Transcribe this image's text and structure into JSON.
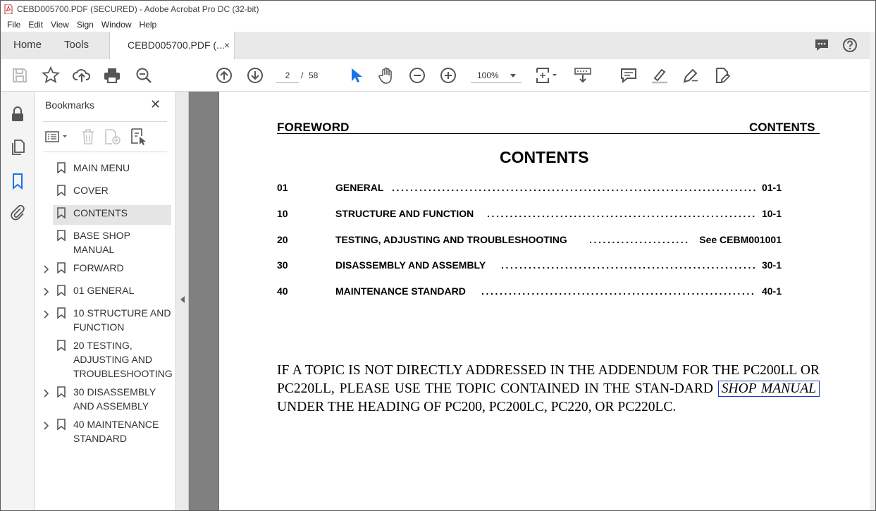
{
  "window": {
    "title": "CEBD005700.PDF (SECURED) - Adobe Acrobat Pro DC (32-bit)"
  },
  "menu": [
    "File",
    "Edit",
    "View",
    "Sign",
    "Window",
    "Help"
  ],
  "tabs": {
    "home": "Home",
    "tools": "Tools",
    "document": "CEBD005700.PDF (...",
    "close": "×"
  },
  "toolbar": {
    "page_current": "2",
    "page_sep": "/",
    "page_total": "58",
    "zoom": "100%"
  },
  "bookmarks": {
    "title": "Bookmarks",
    "close": "✕",
    "items": [
      {
        "label": "MAIN MENU",
        "expandable": false,
        "selected": false
      },
      {
        "label": "COVER",
        "expandable": false,
        "selected": false
      },
      {
        "label": "CONTENTS",
        "expandable": false,
        "selected": true
      },
      {
        "label": "BASE SHOP MANUAL",
        "expandable": false,
        "selected": false
      },
      {
        "label": "FORWARD",
        "expandable": true,
        "selected": false
      },
      {
        "label": "01 GENERAL",
        "expandable": true,
        "selected": false
      },
      {
        "label": "10 STRUCTURE AND FUNCTION",
        "expandable": true,
        "selected": false
      },
      {
        "label": "20 TESTING, ADJUSTING AND TROUBLESHOOTING",
        "expandable": false,
        "selected": false
      },
      {
        "label": "30 DISASSEMBLY AND ASSEMBLY",
        "expandable": true,
        "selected": false
      },
      {
        "label": "40 MAINTENANCE STANDARD",
        "expandable": true,
        "selected": false
      }
    ]
  },
  "document": {
    "header_left": "FOREWORD",
    "header_right": "CONTENTS",
    "title": "CONTENTS",
    "toc": [
      {
        "num": "01",
        "title": "GENERAL",
        "page": "01-1"
      },
      {
        "num": "10",
        "title": "STRUCTURE AND FUNCTION",
        "page": "10-1"
      },
      {
        "num": "20",
        "title": "TESTING, ADJUSTING AND TROUBLESHOOTING",
        "page": "See CEBM001001"
      },
      {
        "num": "30",
        "title": "DISASSEMBLY AND ASSEMBLY",
        "page": "30-1"
      },
      {
        "num": "40",
        "title": "MAINTENANCE STANDARD",
        "page": "40-1"
      }
    ],
    "notice_before": "IF A TOPIC IS NOT DIRECTLY ADDRESSED IN THE ADDENDUM FOR THE PC200LL OR PC220LL, PLEASE USE THE TOPIC CONTAINED IN THE STAN-DARD ",
    "notice_link": "SHOP MANUAL",
    "notice_after": " UNDER THE HEADING OF PC200, PC200LC, PC220, OR PC220LC."
  },
  "colors": {
    "accent": "#1a73e8",
    "link_box": "#1a3ec7",
    "selected_row": "#e5e5e5",
    "panel_gray": "#808080"
  }
}
